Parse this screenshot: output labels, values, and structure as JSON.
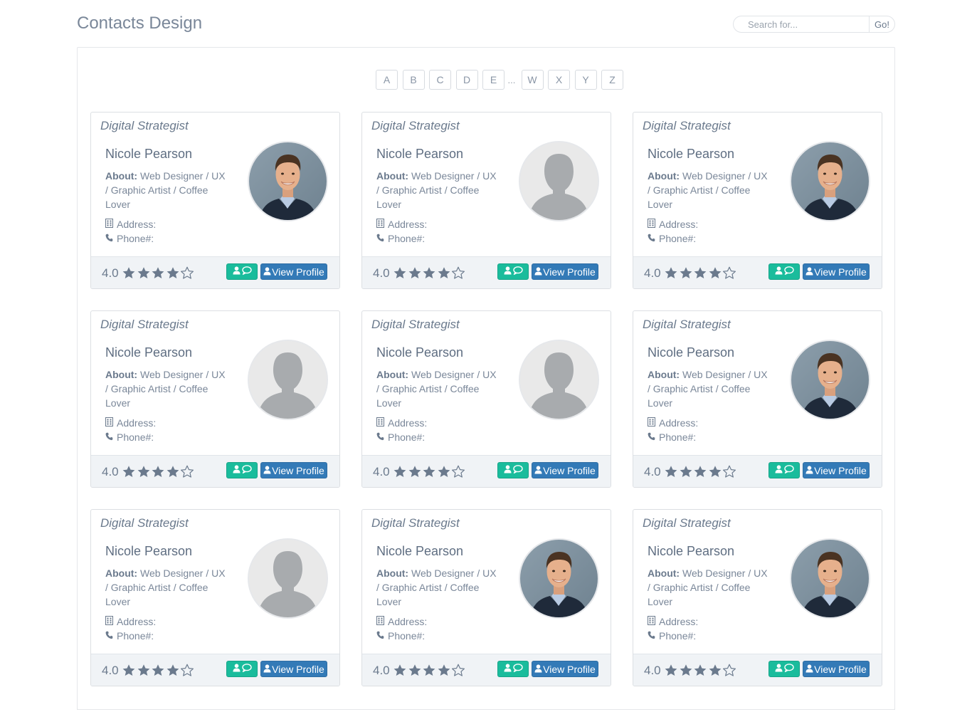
{
  "header": {
    "title": "Contacts Design",
    "search": {
      "placeholder": "Search for...",
      "value": ""
    },
    "go_label": "Go!"
  },
  "alphabet": {
    "letters_start": [
      "A",
      "B",
      "C",
      "D",
      "E"
    ],
    "ellipsis": "...",
    "letters_end": [
      "W",
      "X",
      "Y",
      "Z"
    ]
  },
  "labels": {
    "about": "About:",
    "address": "Address:",
    "phone": "Phone#:",
    "view_profile": "View Profile"
  },
  "colors": {
    "accent_green": "#1abc9c",
    "accent_blue": "#337ab7",
    "star": "#6b7a8d"
  },
  "icons": {
    "address": "building-icon",
    "phone": "phone-icon",
    "message": "user-comment-icon",
    "profile": "user-icon",
    "star_filled": "star-icon",
    "star_empty": "star-outline-icon"
  },
  "contacts": [
    {
      "title": "Digital Strategist",
      "name": "Nicole Pearson",
      "about": "Web Designer / UX / Graphic Artist / Coffee Lover",
      "rating": "4.0",
      "stars_filled": 4,
      "stars_total": 5,
      "avatar": "photo"
    },
    {
      "title": "Digital Strategist",
      "name": "Nicole Pearson",
      "about": "Web Designer / UX / Graphic Artist / Coffee Lover",
      "rating": "4.0",
      "stars_filled": 4,
      "stars_total": 5,
      "avatar": "placeholder"
    },
    {
      "title": "Digital Strategist",
      "name": "Nicole Pearson",
      "about": "Web Designer / UX / Graphic Artist / Coffee Lover",
      "rating": "4.0",
      "stars_filled": 4,
      "stars_total": 5,
      "avatar": "photo"
    },
    {
      "title": "Digital Strategist",
      "name": "Nicole Pearson",
      "about": "Web Designer / UX / Graphic Artist / Coffee Lover",
      "rating": "4.0",
      "stars_filled": 4,
      "stars_total": 5,
      "avatar": "placeholder"
    },
    {
      "title": "Digital Strategist",
      "name": "Nicole Pearson",
      "about": "Web Designer / UX / Graphic Artist / Coffee Lover",
      "rating": "4.0",
      "stars_filled": 4,
      "stars_total": 5,
      "avatar": "placeholder"
    },
    {
      "title": "Digital Strategist",
      "name": "Nicole Pearson",
      "about": "Web Designer / UX / Graphic Artist / Coffee Lover",
      "rating": "4.0",
      "stars_filled": 4,
      "stars_total": 5,
      "avatar": "photo"
    },
    {
      "title": "Digital Strategist",
      "name": "Nicole Pearson",
      "about": "Web Designer / UX / Graphic Artist / Coffee Lover",
      "rating": "4.0",
      "stars_filled": 4,
      "stars_total": 5,
      "avatar": "placeholder"
    },
    {
      "title": "Digital Strategist",
      "name": "Nicole Pearson",
      "about": "Web Designer / UX / Graphic Artist / Coffee Lover",
      "rating": "4.0",
      "stars_filled": 4,
      "stars_total": 5,
      "avatar": "photo"
    },
    {
      "title": "Digital Strategist",
      "name": "Nicole Pearson",
      "about": "Web Designer / UX / Graphic Artist / Coffee Lover",
      "rating": "4.0",
      "stars_filled": 4,
      "stars_total": 5,
      "avatar": "photo"
    }
  ]
}
